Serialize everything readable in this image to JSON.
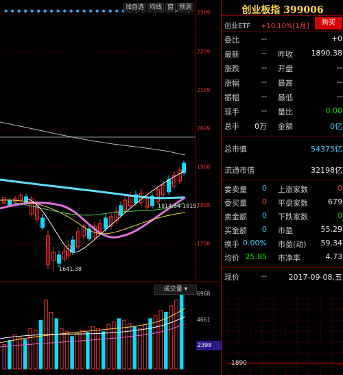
{
  "toolbar": {
    "items": [
      "加自选",
      "均线",
      "窗",
      "预测"
    ]
  },
  "price_axis": [
    "2309",
    "2209",
    "2109",
    "2009",
    "1908",
    "1808",
    "1708"
  ],
  "volume_axis": [
    "6968",
    "4661",
    "2398"
  ],
  "chart_labels": {
    "low": "1641.38",
    "range": "1814.54-1815."
  },
  "volume": {
    "title": "成交量"
  },
  "info": {
    "title": "创业板指 399006",
    "etf_name": "创业ETF",
    "etf_change": "+10.10%[1月]",
    "buy_label": "购买",
    "rows": [
      {
        "l1": "委比",
        "v1": "--",
        "l2": "",
        "v2": "+0"
      },
      {
        "l1": "最新",
        "v1": "--",
        "l2": "昨收",
        "v2": "1890.38"
      },
      {
        "l1": "涨跌",
        "v1": "--",
        "l2": "开盘",
        "v2": "--"
      },
      {
        "l1": "涨幅",
        "v1": "--",
        "l2": "最高",
        "v2": "--"
      },
      {
        "l1": "振幅",
        "v1": "--",
        "l2": "最低",
        "v2": "--"
      },
      {
        "l1": "现手",
        "v1": "--",
        "l2": "量比",
        "v2": "0.00"
      },
      {
        "l1": "总手",
        "v1": "0万",
        "l2": "金额",
        "v2": "0亿"
      },
      {
        "l1": "总市值",
        "v1": "",
        "l2": "",
        "v2": "54375亿"
      },
      {
        "l1": "流通市值",
        "v1": "",
        "l2": "",
        "v2": "32198亿"
      },
      {
        "l1": "委卖量",
        "v1": "0",
        "l2": "上涨家数",
        "v2": "0"
      },
      {
        "l1": "委买量",
        "v1": "0",
        "l2": "平盘家数",
        "v2": "679"
      },
      {
        "l1": "卖金额",
        "v1": "0",
        "l2": "下跌家数",
        "v2": "0"
      },
      {
        "l1": "买金额",
        "v1": "0",
        "l2": "市盈",
        "v2": "55.29"
      },
      {
        "l1": "换手",
        "v1": "0.00%",
        "l2": "市盈(动)",
        "v2": "59.34"
      },
      {
        "l1": "均价",
        "v1": "25.85",
        "l2": "市净率",
        "v2": "4.73"
      },
      {
        "l1": "现价",
        "v1": "--",
        "l2": "",
        "v2": "2017-09-08,五"
      }
    ],
    "mini_label": "1890"
  }
}
